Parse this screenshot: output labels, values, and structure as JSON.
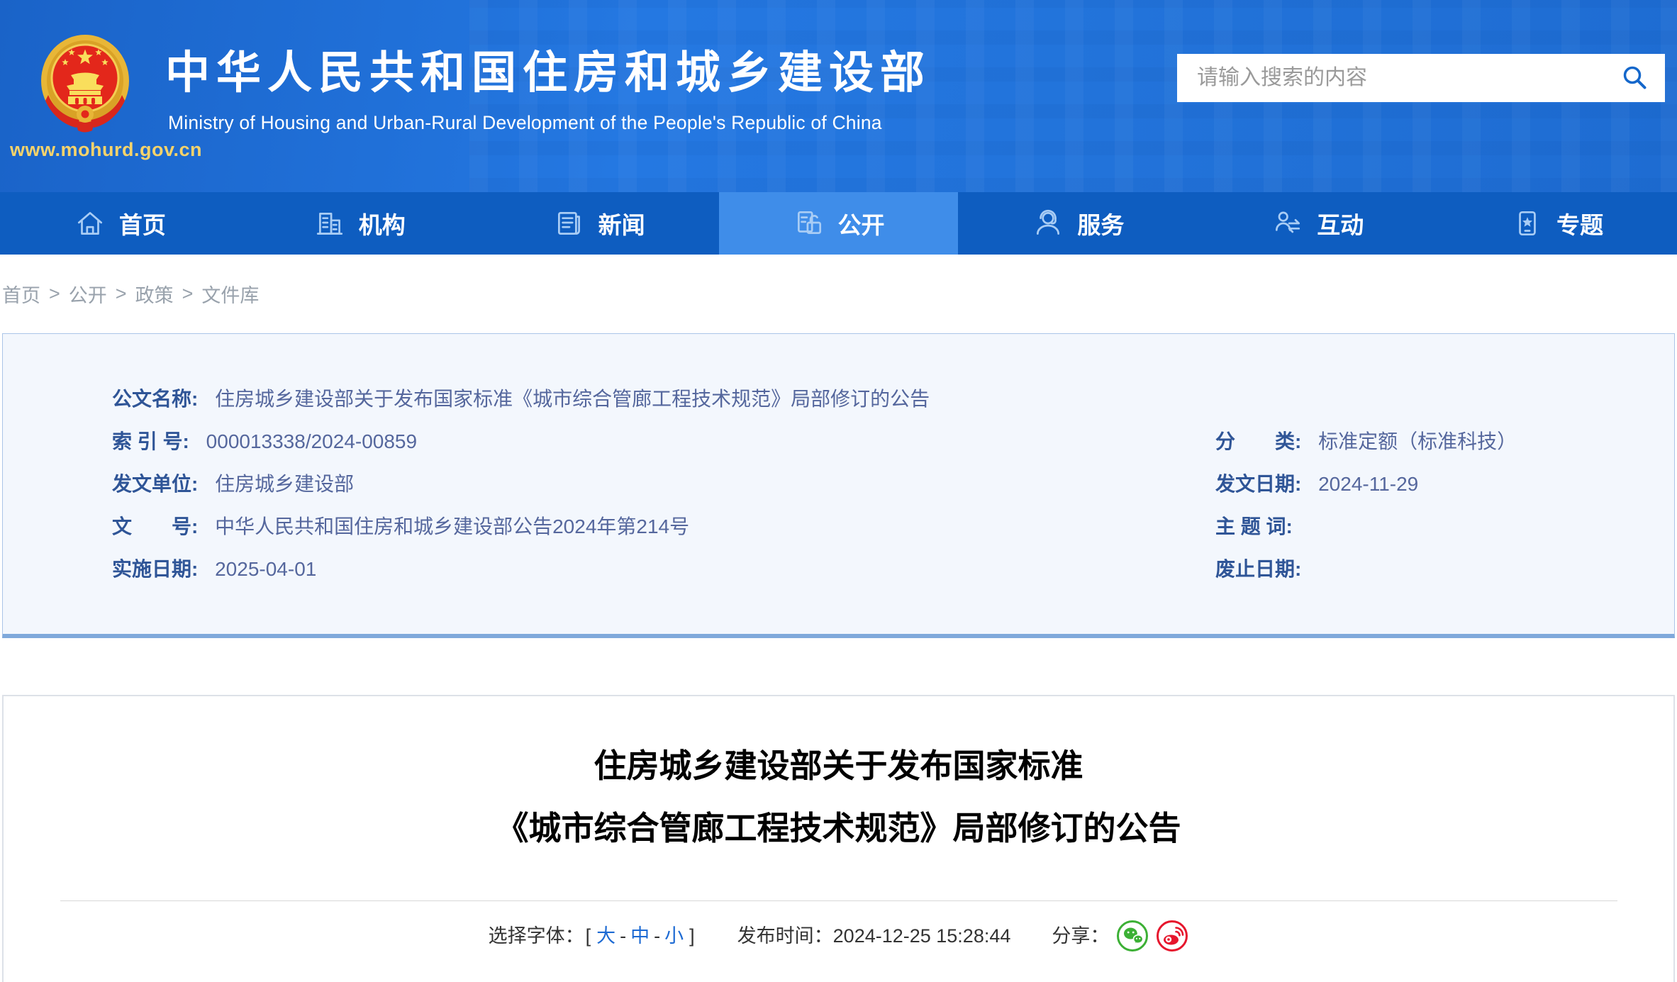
{
  "colors": {
    "header_blue": "#2174DC",
    "nav_blue": "#0E5DC0",
    "nav_active_blue": "#3F8DE9",
    "gold": "#F5D36B",
    "emblem_red": "#E3271B",
    "info_bg": "#F3F7FD",
    "info_border": "#ABC5E8",
    "info_border_bottom": "#7FA9DB",
    "label_blue": "#2F5597",
    "value_blue": "#55679D",
    "link_blue": "#1D6AD3",
    "breadcrumb_gray": "#99A2AC",
    "wechat_green": "#3CB035",
    "weibo_red": "#E6162D"
  },
  "header": {
    "site_name": "中华人民共和国住房和城乡建设部",
    "site_name_en": "Ministry of Housing and Urban-Rural Development of the People's Republic of China",
    "site_url": "www.mohurd.gov.cn",
    "search_placeholder": "请输入搜索的内容"
  },
  "nav": {
    "items": [
      {
        "label": "首页"
      },
      {
        "label": "机构"
      },
      {
        "label": "新闻"
      },
      {
        "label": "公开"
      },
      {
        "label": "服务"
      },
      {
        "label": "互动"
      },
      {
        "label": "专题"
      }
    ]
  },
  "breadcrumb": {
    "separator": ">",
    "items": [
      "首页",
      "公开",
      "政策",
      "文件库"
    ]
  },
  "doc_info": {
    "name_label": "公文名称:",
    "name_value": "住房城乡建设部关于发布国家标准《城市综合管廊工程技术规范》局部修订的公告",
    "left_rows": [
      {
        "label": "索 引 号:",
        "value": "000013338/2024-00859"
      },
      {
        "label": "发文单位:",
        "value": "住房城乡建设部"
      },
      {
        "label": "文　　号:",
        "value": "中华人民共和国住房和城乡建设部公告2024年第214号"
      },
      {
        "label": "实施日期:",
        "value": "2025-04-01"
      }
    ],
    "right_rows": [
      {
        "label": "分　　类:",
        "value": "标准定额（标准科技）"
      },
      {
        "label": "发文日期:",
        "value": "2024-11-29"
      },
      {
        "label": "主 题 词:",
        "value": ""
      },
      {
        "label": "废止日期:",
        "value": ""
      }
    ]
  },
  "article": {
    "title_line1": "住房城乡建设部关于发布国家标准",
    "title_line2": "《城市综合管廊工程技术规范》局部修订的公告",
    "font_selector": {
      "label": "选择字体：",
      "open": "[",
      "large": "大",
      "dash1": "-",
      "medium": "中",
      "dash2": "-",
      "small": "小",
      "close": "]"
    },
    "publish_label": "发布时间：",
    "publish_time": "2024-12-25 15:28:44",
    "share_label": "分享："
  }
}
